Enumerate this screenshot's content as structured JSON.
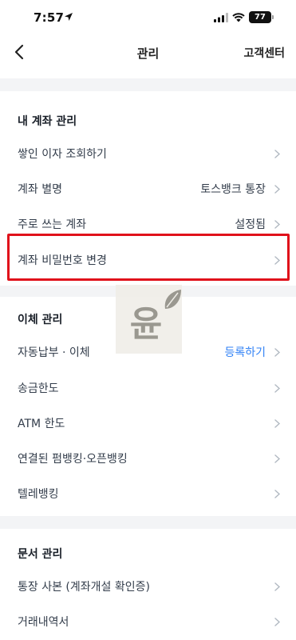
{
  "status_bar": {
    "time": "7:57",
    "battery": "77"
  },
  "nav": {
    "title": "관리",
    "right_action": "고객센터"
  },
  "sections": {
    "account": {
      "title": "내 계좌 관리",
      "items": [
        {
          "label": "쌓인 이자 조회하기",
          "value": ""
        },
        {
          "label": "계좌 별명",
          "value": "토스뱅크 통장"
        },
        {
          "label": "주로 쓰는 계좌",
          "value": "설정됨"
        },
        {
          "label": "계좌 비밀번호 변경",
          "value": ""
        }
      ]
    },
    "transfer": {
      "title": "이체 관리",
      "items": [
        {
          "label": "자동납부 · 이체",
          "value": "등록하기"
        },
        {
          "label": "송금한도",
          "value": ""
        },
        {
          "label": "ATM 한도",
          "value": ""
        },
        {
          "label": "연결된 펌뱅킹·오픈뱅킹",
          "value": ""
        },
        {
          "label": "텔레뱅킹",
          "value": ""
        }
      ]
    },
    "documents": {
      "title": "문서 관리",
      "items": [
        {
          "label": "통장 사본 (계좌개설 확인증)",
          "value": ""
        },
        {
          "label": "거래내역서",
          "value": ""
        }
      ]
    }
  },
  "watermark": {
    "text": "윤"
  },
  "colors": {
    "accent_link": "#3182f6",
    "highlight": "#e0121b",
    "divider": "#f3f4f6"
  }
}
